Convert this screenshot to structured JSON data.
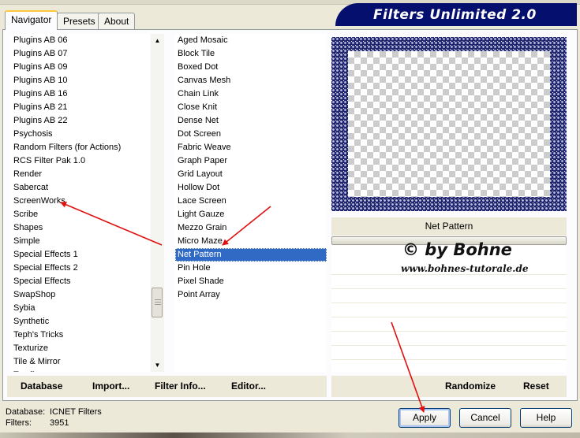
{
  "tabs": [
    {
      "label": "Navigator",
      "active": true
    },
    {
      "label": "Presets",
      "active": false
    },
    {
      "label": "About",
      "active": false
    }
  ],
  "banner": {
    "title": "Filters Unlimited 2.0"
  },
  "categories": {
    "items": [
      "Plugins AB 06",
      "Plugins AB 07",
      "Plugins AB 09",
      "Plugins AB 10",
      "Plugins AB 16",
      "Plugins AB 21",
      "Plugins AB 22",
      "Psychosis",
      "Random Filters (for Actions)",
      "RCS Filter Pak 1.0",
      "Render",
      "Sabercat",
      "ScreenWorks",
      "Scribe",
      "Shapes",
      "Simple",
      "Special Effects 1",
      "Special Effects 2",
      "Special Effects",
      "SwapShop",
      "Sybia",
      "Synthetic",
      "Teph's Tricks",
      "Texturize",
      "Tile & Mirror",
      "Toadies"
    ]
  },
  "filters": {
    "items": [
      "Aged Mosaic",
      "Block Tile",
      "Boxed Dot",
      "Canvas Mesh",
      "Chain Link",
      "Close Knit",
      "Dense Net",
      "Dot Screen",
      "Fabric Weave",
      "Graph Paper",
      "Grid Layout",
      "Hollow Dot",
      "Lace Screen",
      "Light Gauze",
      "Mezzo Grain",
      "Micro Maze",
      "Net Pattern",
      "Pin Hole",
      "Pixel Shade",
      "Point Array"
    ],
    "selected": "Net Pattern"
  },
  "preview": {
    "filter_name": "Net Pattern"
  },
  "watermark": {
    "line1": "© by Bohne",
    "line2": "www.bohnes-tutorale.de"
  },
  "toolbar": {
    "database": "Database",
    "import": "Import...",
    "filter_info": "Filter Info...",
    "editor": "Editor...",
    "randomize": "Randomize",
    "reset": "Reset"
  },
  "status": {
    "database_label": "Database:",
    "database_value": "ICNET Filters",
    "filters_label": "Filters:",
    "filters_value": "3951"
  },
  "buttons": {
    "apply": "Apply",
    "cancel": "Cancel",
    "help": "Help"
  },
  "colors": {
    "banner": "#050f6e",
    "selection": "#316ac5",
    "arrow": "#e01010"
  }
}
